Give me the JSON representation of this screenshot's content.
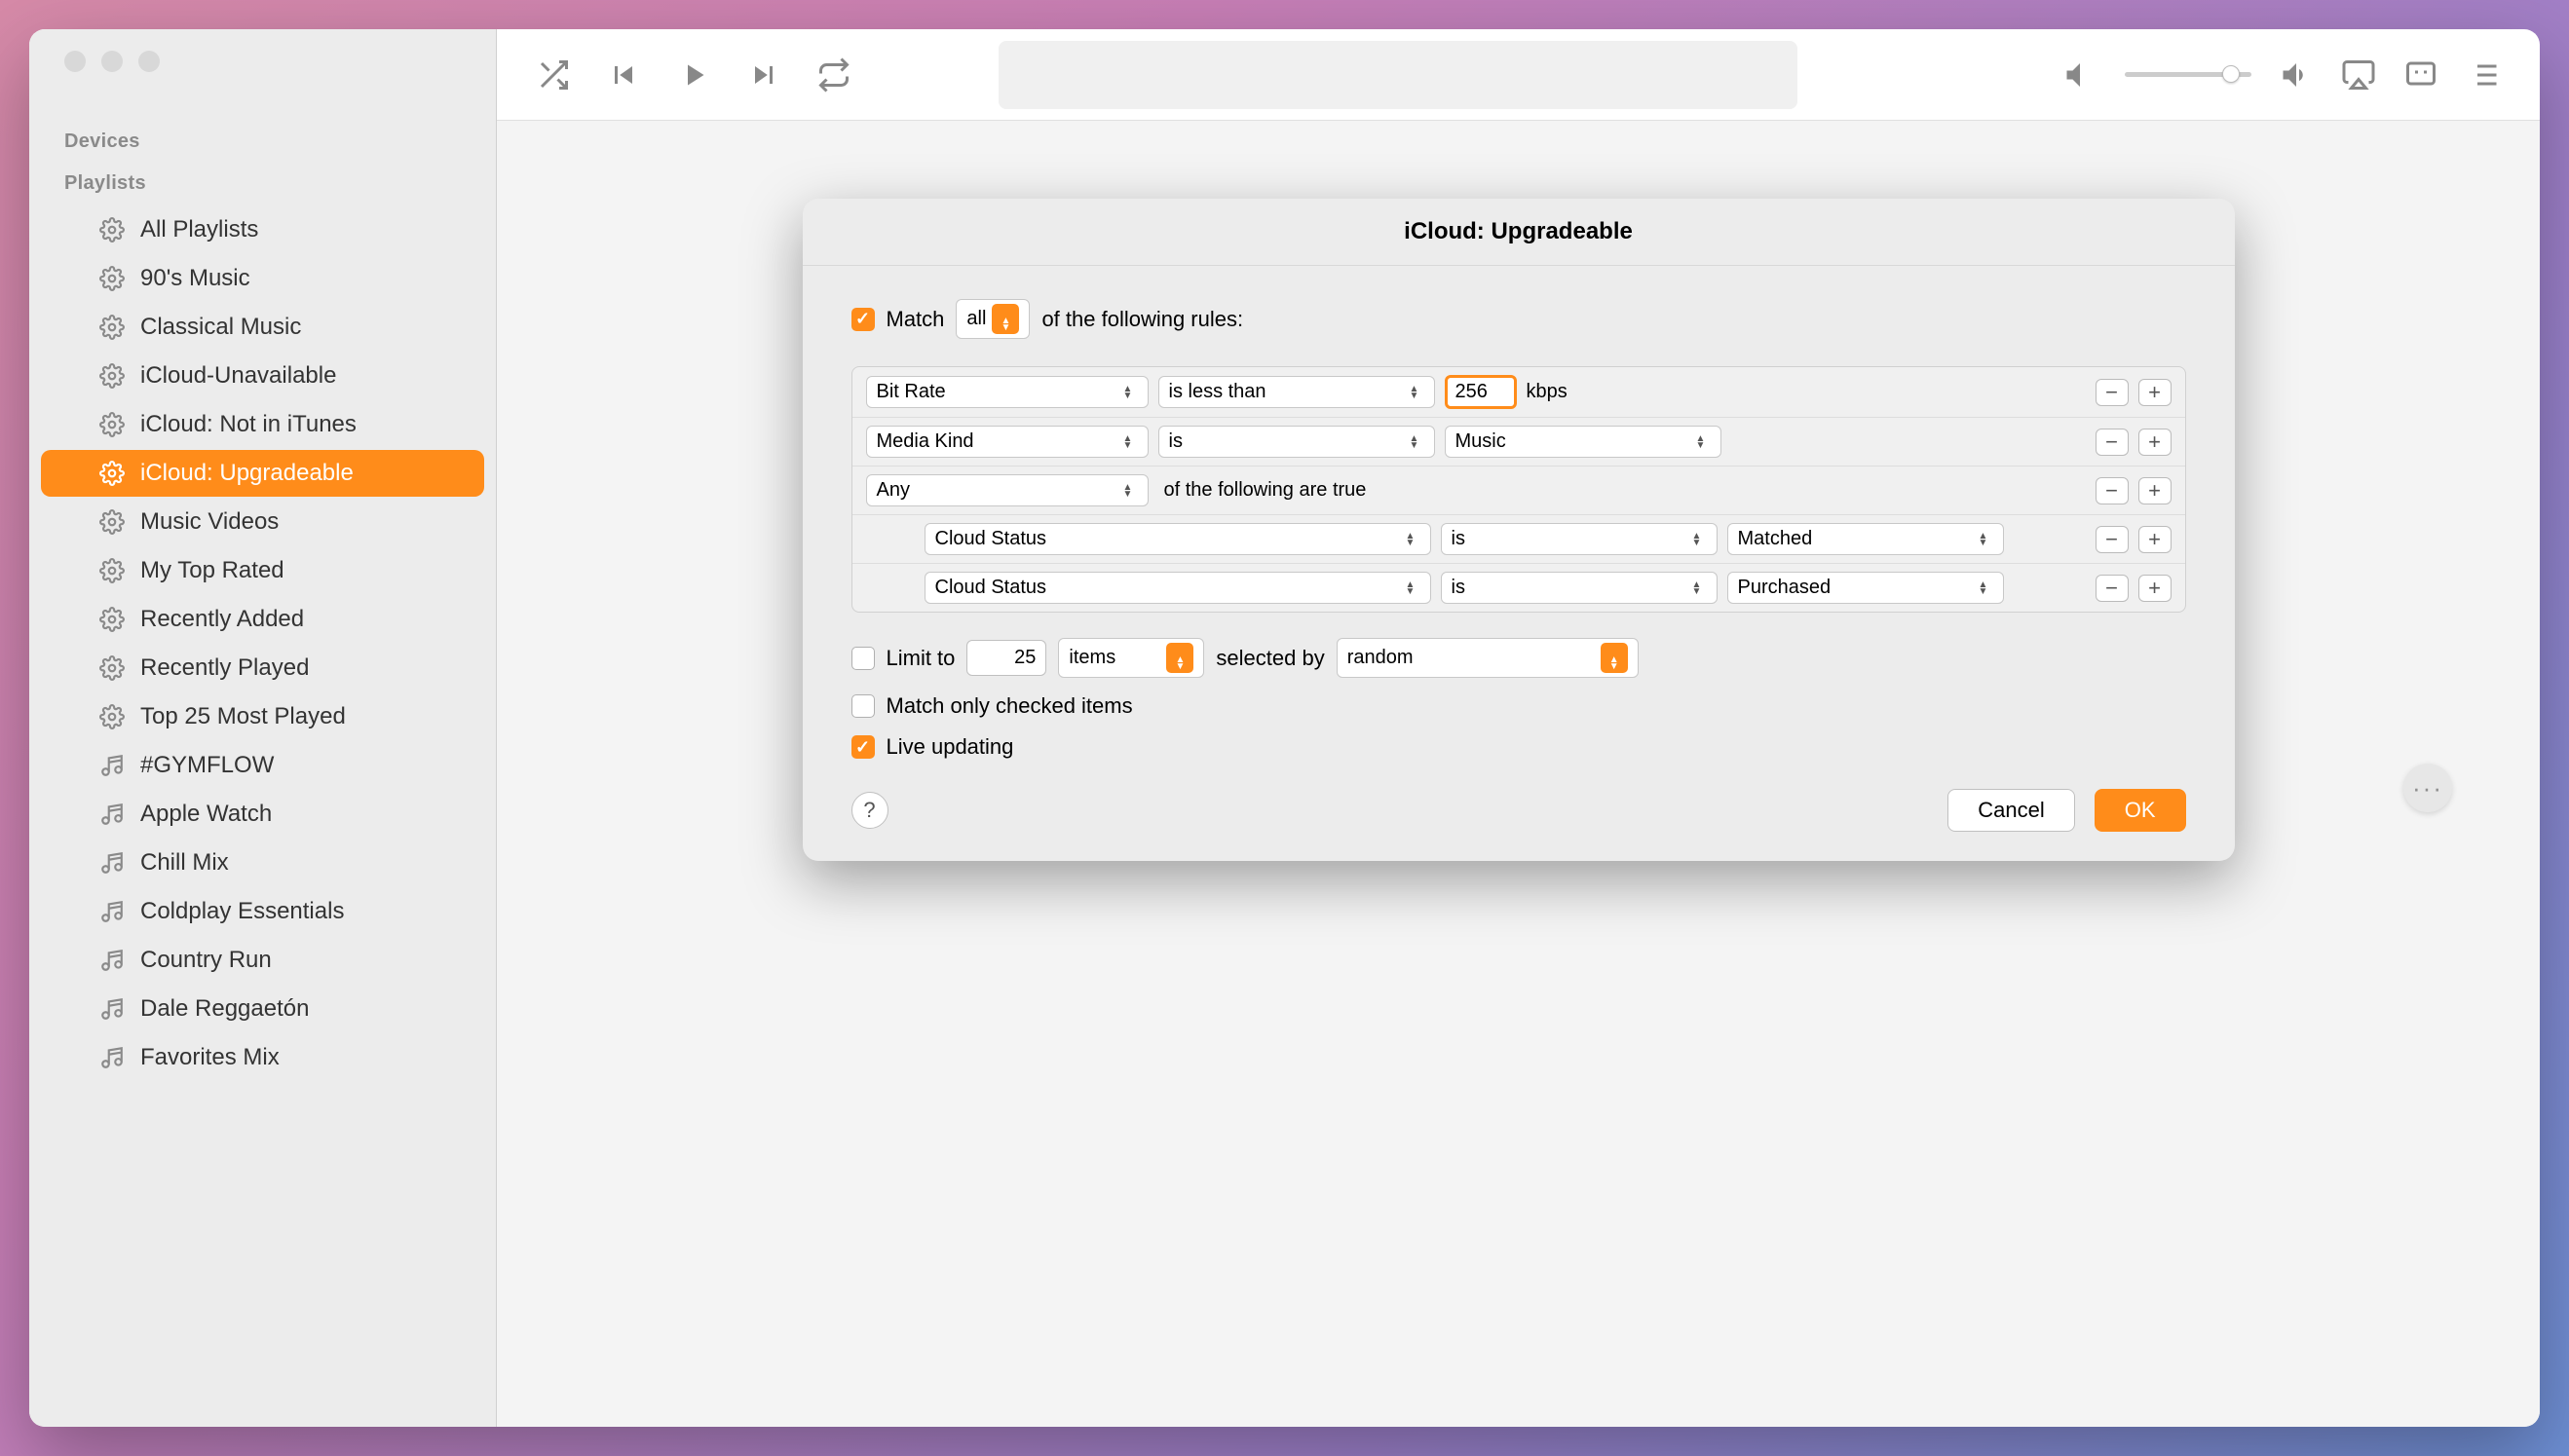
{
  "sidebar": {
    "sections": {
      "devices_header": "Devices",
      "playlists_header": "Playlists"
    },
    "smart_playlists": [
      "All Playlists",
      "90's Music",
      "Classical Music",
      "iCloud-Unavailable",
      "iCloud: Not in iTunes",
      "iCloud: Upgradeable",
      "Music Videos",
      "My Top Rated",
      "Recently Added",
      "Recently Played",
      "Top 25 Most Played"
    ],
    "regular_playlists": [
      "#GYMFLOW",
      "Apple Watch",
      "Chill Mix",
      "Coldplay Essentials",
      "Country Run",
      "Dale Reggaetón",
      "Favorites Mix"
    ],
    "selected_index": 5
  },
  "sheet": {
    "title": "iCloud: Upgradeable",
    "match_checked": true,
    "match_label": "Match",
    "match_scope": "all",
    "match_suffix": "of the following rules:",
    "rules": [
      {
        "field": "Bit Rate",
        "op": "is less than",
        "value": "256",
        "unit": "kbps",
        "nested": false
      },
      {
        "field": "Media Kind",
        "op": "is",
        "value2": "Music",
        "nested": false
      },
      {
        "field": "Any",
        "link": "of the following are true",
        "nested": false
      },
      {
        "field": "Cloud Status",
        "op": "is",
        "value2": "Matched",
        "nested": true
      },
      {
        "field": "Cloud Status",
        "op": "is",
        "value2": "Purchased",
        "nested": true
      }
    ],
    "limit": {
      "checked": false,
      "label": "Limit to",
      "count": "25",
      "unit": "items",
      "selected_by_label": "selected by",
      "method": "random"
    },
    "match_only_checked": {
      "checked": false,
      "label": "Match only checked items"
    },
    "live_updating": {
      "checked": true,
      "label": "Live updating"
    },
    "buttons": {
      "help": "?",
      "cancel": "Cancel",
      "ok": "OK"
    }
  }
}
